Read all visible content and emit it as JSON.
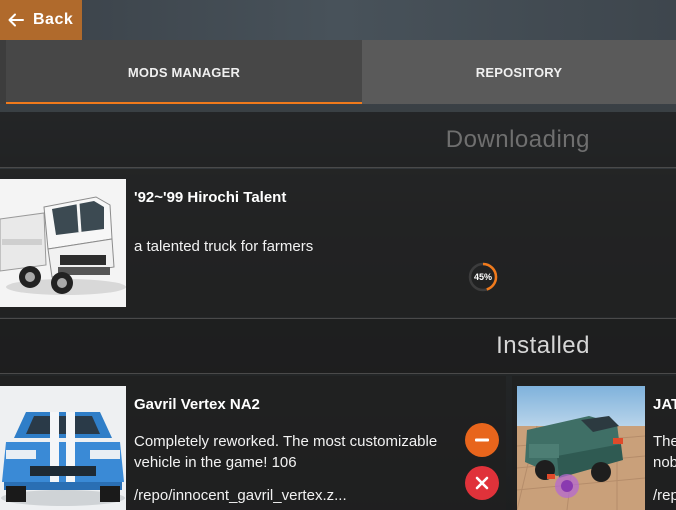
{
  "topbar": {
    "back_label": "Back"
  },
  "tabs": [
    {
      "label": "MODS MANAGER",
      "active": true
    },
    {
      "label": "REPOSITORY",
      "active": false
    }
  ],
  "sections": {
    "downloading": "Downloading",
    "installed": "Installed"
  },
  "downloading": [
    {
      "title": "'92~'99 Hirochi Talent",
      "description": "a talented truck for farmers",
      "progress_label": "45%",
      "progress": 0.45
    }
  ],
  "installed": [
    {
      "title": "Gavril Vertex NA2",
      "description": "Completely reworked. The most customizable vehicle in the game! 106",
      "path": "/repo/innocent_gavril_vertex.z..."
    },
    {
      "title": "JAT",
      "description": "The nob",
      "path": "/rep"
    }
  ],
  "icons": {
    "back": "arrow-left-icon",
    "disable": "minus-circle-icon",
    "delete": "close-circle-icon"
  },
  "colors": {
    "accent": "#f07a1c",
    "back_button": "#b06a2c",
    "delete": "#e0323a",
    "disable": "#e8651c"
  }
}
